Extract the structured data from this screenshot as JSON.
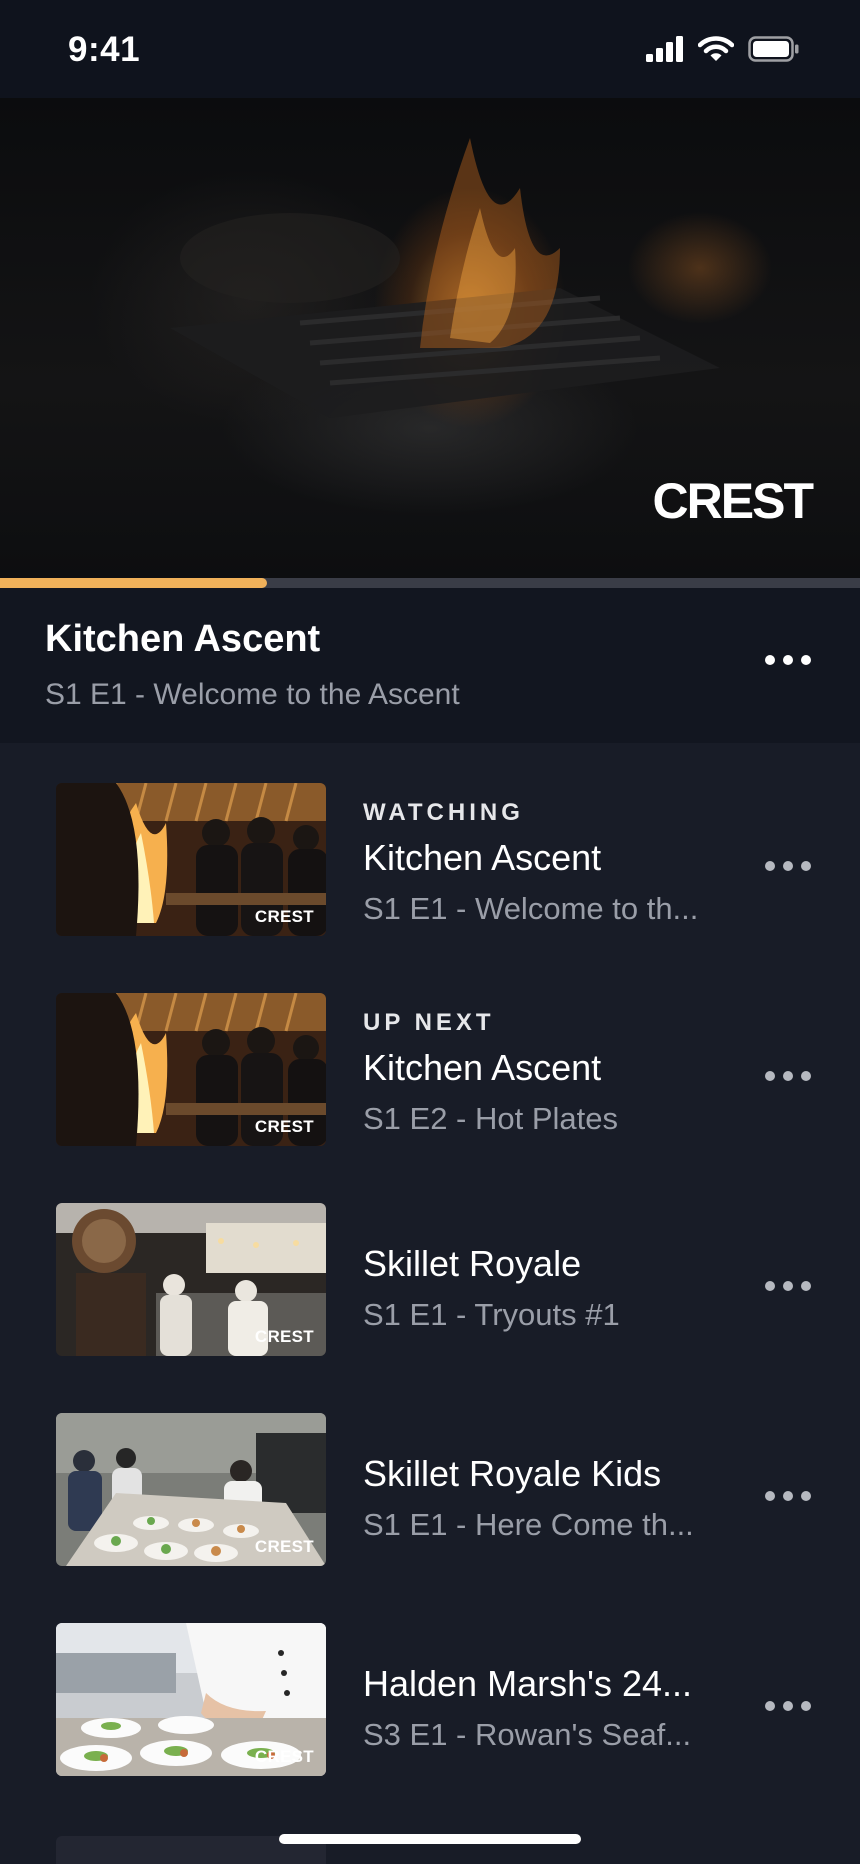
{
  "status_bar": {
    "time": "9:41",
    "battery_level": 1.0
  },
  "hero": {
    "logo": "CREST",
    "progress": 0.31
  },
  "now_playing": {
    "title": "Kitchen Ascent",
    "subtitle": "S1 E1 - Welcome to the Ascent",
    "more_icon": "ellipsis-icon"
  },
  "episodes": [
    {
      "label": "WATCHING",
      "title": "Kitchen Ascent",
      "subtitle": "S1 E1 - Welcome to th...",
      "badge": "CREST",
      "thumb": "kitchen-flames"
    },
    {
      "label": "UP NEXT",
      "title": "Kitchen Ascent",
      "subtitle": "S1 E2 - Hot Plates",
      "badge": "CREST",
      "thumb": "kitchen-flames"
    },
    {
      "label": "",
      "title": "Skillet Royale",
      "subtitle": "S1 E1 - Tryouts #1",
      "badge": "CREST",
      "thumb": "steel-kitchen"
    },
    {
      "label": "",
      "title": "Skillet Royale Kids",
      "subtitle": "S1 E1 - Here Come th...",
      "badge": "CREST",
      "thumb": "plating-table"
    },
    {
      "label": "",
      "title": "Halden Marsh's 24...",
      "subtitle": "S3 E1 - Rowan's Seaf...",
      "badge": "CREST",
      "thumb": "white-plates"
    }
  ],
  "colors": {
    "accent": "#f0b15a",
    "background": "#181c27",
    "header": "#121620"
  }
}
